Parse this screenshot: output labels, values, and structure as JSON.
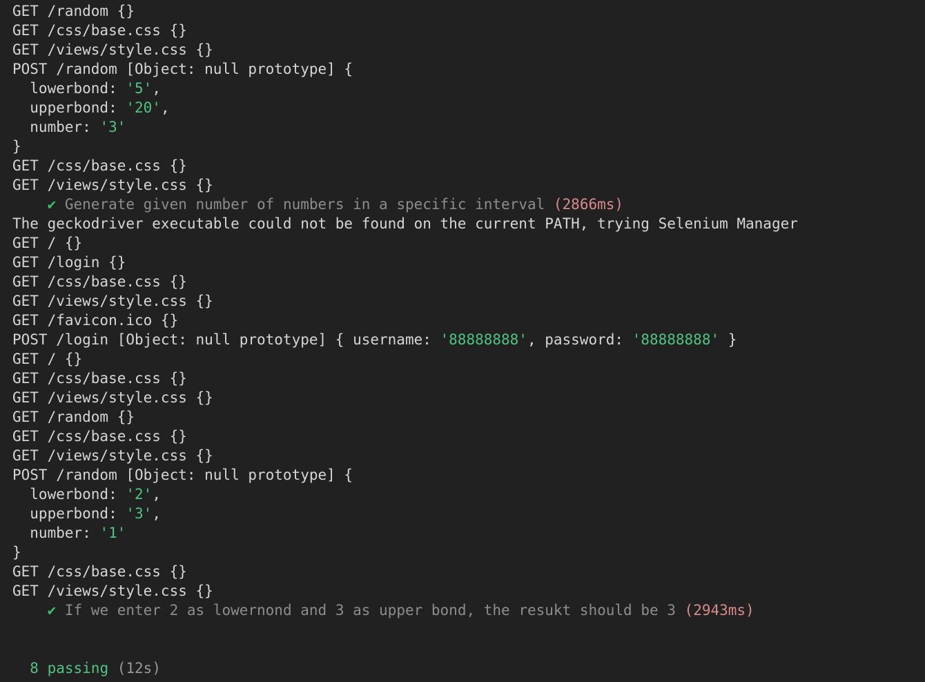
{
  "terminal": {
    "title": "mocha test runner output",
    "background_color": "#212121",
    "colors": {
      "default_text": "#d6d6d6",
      "string_value": "#4fc483",
      "dim_text": "#8d8d8d",
      "timing_slow": "#d98b8b",
      "checkmark": "#3fbf6f",
      "passing": "#4fc483",
      "duration": "#9a9a9a"
    },
    "summary": {
      "passing_count": "8 passing",
      "total_duration": "(12s)"
    },
    "lines": [
      {
        "id": 0,
        "type": "log",
        "segments": [
          {
            "text": "GET /random {}",
            "style": "default"
          }
        ]
      },
      {
        "id": 1,
        "type": "log",
        "segments": [
          {
            "text": "GET /css/base.css {}",
            "style": "default"
          }
        ]
      },
      {
        "id": 2,
        "type": "log",
        "segments": [
          {
            "text": "GET /views/style.css {}",
            "style": "default"
          }
        ]
      },
      {
        "id": 3,
        "type": "log",
        "segments": [
          {
            "text": "POST /random [Object: null prototype] {",
            "style": "default"
          }
        ]
      },
      {
        "id": 4,
        "type": "log",
        "segments": [
          {
            "text": "  lowerbond: ",
            "style": "default"
          },
          {
            "text": "'5'",
            "style": "value"
          },
          {
            "text": ",",
            "style": "default"
          }
        ]
      },
      {
        "id": 5,
        "type": "log",
        "segments": [
          {
            "text": "  upperbond: ",
            "style": "default"
          },
          {
            "text": "'20'",
            "style": "value"
          },
          {
            "text": ",",
            "style": "default"
          }
        ]
      },
      {
        "id": 6,
        "type": "log",
        "segments": [
          {
            "text": "  number: ",
            "style": "default"
          },
          {
            "text": "'3'",
            "style": "value"
          }
        ]
      },
      {
        "id": 7,
        "type": "log",
        "segments": [
          {
            "text": "}",
            "style": "default"
          }
        ]
      },
      {
        "id": 8,
        "type": "log",
        "segments": [
          {
            "text": "GET /css/base.css {}",
            "style": "default"
          }
        ]
      },
      {
        "id": 9,
        "type": "log",
        "segments": [
          {
            "text": "GET /views/style.css {}",
            "style": "default"
          }
        ]
      },
      {
        "id": 10,
        "type": "test",
        "segments": [
          {
            "text": "    ",
            "style": "default"
          },
          {
            "text": "✔",
            "style": "check"
          },
          {
            "text": " Generate given number of numbers in a specific interval ",
            "style": "dim"
          },
          {
            "text": "(2866ms)",
            "style": "time"
          }
        ]
      },
      {
        "id": 11,
        "type": "log",
        "segments": [
          {
            "text": "The geckodriver executable could not be found on the current PATH, trying Selenium Manager",
            "style": "default"
          }
        ]
      },
      {
        "id": 12,
        "type": "log",
        "segments": [
          {
            "text": "GET / {}",
            "style": "default"
          }
        ]
      },
      {
        "id": 13,
        "type": "log",
        "segments": [
          {
            "text": "GET /login {}",
            "style": "default"
          }
        ]
      },
      {
        "id": 14,
        "type": "log",
        "segments": [
          {
            "text": "GET /css/base.css {}",
            "style": "default"
          }
        ]
      },
      {
        "id": 15,
        "type": "log",
        "segments": [
          {
            "text": "GET /views/style.css {}",
            "style": "default"
          }
        ]
      },
      {
        "id": 16,
        "type": "log",
        "segments": [
          {
            "text": "GET /favicon.ico {}",
            "style": "default"
          }
        ]
      },
      {
        "id": 17,
        "type": "log",
        "segments": [
          {
            "text": "POST /login [Object: null prototype] { username: ",
            "style": "default"
          },
          {
            "text": "'88888888'",
            "style": "value"
          },
          {
            "text": ", password: ",
            "style": "default"
          },
          {
            "text": "'88888888'",
            "style": "value"
          },
          {
            "text": " }",
            "style": "default"
          }
        ]
      },
      {
        "id": 18,
        "type": "log",
        "segments": [
          {
            "text": "GET / {}",
            "style": "default"
          }
        ]
      },
      {
        "id": 19,
        "type": "log",
        "segments": [
          {
            "text": "GET /css/base.css {}",
            "style": "default"
          }
        ]
      },
      {
        "id": 20,
        "type": "log",
        "segments": [
          {
            "text": "GET /views/style.css {}",
            "style": "default"
          }
        ]
      },
      {
        "id": 21,
        "type": "log",
        "segments": [
          {
            "text": "GET /random {}",
            "style": "default"
          }
        ]
      },
      {
        "id": 22,
        "type": "log",
        "segments": [
          {
            "text": "GET /css/base.css {}",
            "style": "default"
          }
        ]
      },
      {
        "id": 23,
        "type": "log",
        "segments": [
          {
            "text": "GET /views/style.css {}",
            "style": "default"
          }
        ]
      },
      {
        "id": 24,
        "type": "log",
        "segments": [
          {
            "text": "POST /random [Object: null prototype] {",
            "style": "default"
          }
        ]
      },
      {
        "id": 25,
        "type": "log",
        "segments": [
          {
            "text": "  lowerbond: ",
            "style": "default"
          },
          {
            "text": "'2'",
            "style": "value"
          },
          {
            "text": ",",
            "style": "default"
          }
        ]
      },
      {
        "id": 26,
        "type": "log",
        "segments": [
          {
            "text": "  upperbond: ",
            "style": "default"
          },
          {
            "text": "'3'",
            "style": "value"
          },
          {
            "text": ",",
            "style": "default"
          }
        ]
      },
      {
        "id": 27,
        "type": "log",
        "segments": [
          {
            "text": "  number: ",
            "style": "default"
          },
          {
            "text": "'1'",
            "style": "value"
          }
        ]
      },
      {
        "id": 28,
        "type": "log",
        "segments": [
          {
            "text": "}",
            "style": "default"
          }
        ]
      },
      {
        "id": 29,
        "type": "log",
        "segments": [
          {
            "text": "GET /css/base.css {}",
            "style": "default"
          }
        ]
      },
      {
        "id": 30,
        "type": "log",
        "segments": [
          {
            "text": "GET /views/style.css {}",
            "style": "default"
          }
        ]
      },
      {
        "id": 31,
        "type": "test",
        "segments": [
          {
            "text": "    ",
            "style": "default"
          },
          {
            "text": "✔",
            "style": "check"
          },
          {
            "text": " If we enter 2 as lowernond and 3 as upper bond, the resukt should be 3 ",
            "style": "dim"
          },
          {
            "text": "(2943ms)",
            "style": "time"
          }
        ]
      },
      {
        "id": 32,
        "type": "blank",
        "segments": [
          {
            "text": " ",
            "style": "default"
          }
        ]
      },
      {
        "id": 33,
        "type": "blank",
        "segments": [
          {
            "text": " ",
            "style": "default"
          }
        ]
      },
      {
        "id": 34,
        "type": "summary",
        "segments": [
          {
            "text": "  ",
            "style": "default"
          },
          {
            "text": "8 passing",
            "style": "pass"
          },
          {
            "text": " ",
            "style": "default"
          },
          {
            "text": "(12s)",
            "style": "duration"
          }
        ]
      }
    ]
  }
}
